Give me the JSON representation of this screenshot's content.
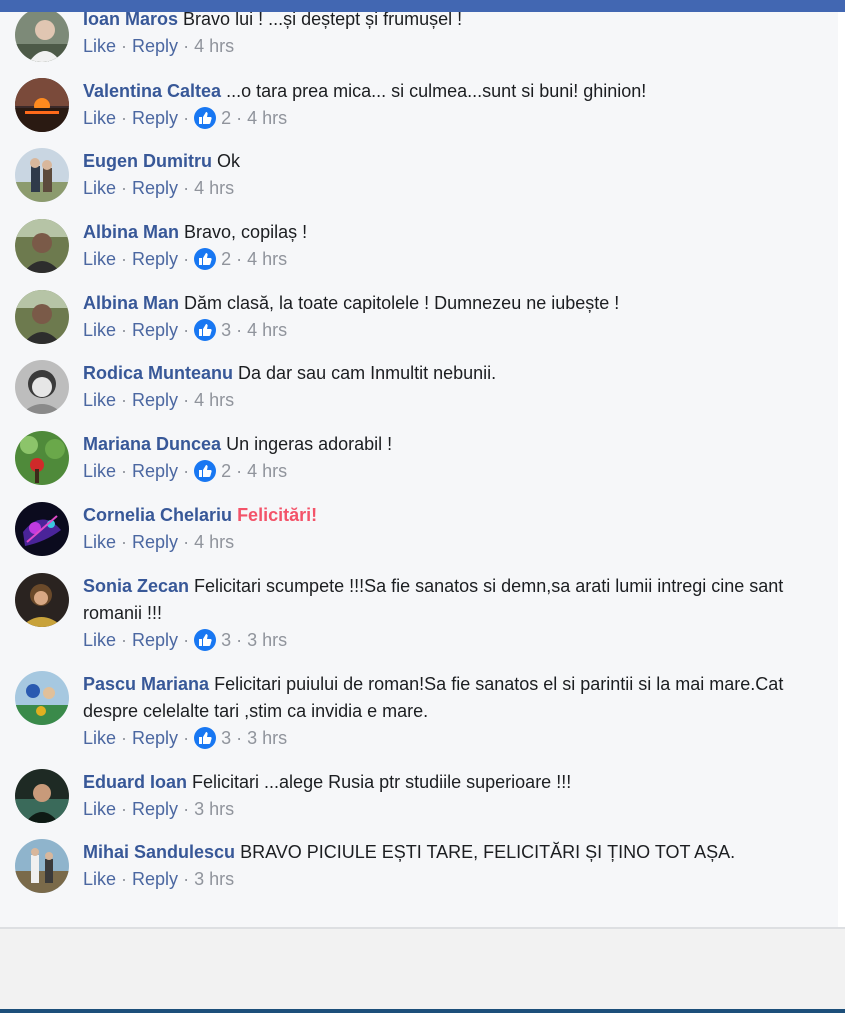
{
  "actions": {
    "like": "Like",
    "reply": "Reply",
    "separator": "·"
  },
  "comments": [
    {
      "author": "Ioan Maros",
      "text": "Bravo lui ! ...și deștept și frumușel !",
      "reactions": "",
      "time": "4 hrs"
    },
    {
      "author": "Valentina Caltea",
      "text": "...o tara prea mica... si culmea...sunt si buni! ghinion!",
      "reactions": "2",
      "time": "4 hrs"
    },
    {
      "author": "Eugen Dumitru",
      "text": "Ok",
      "reactions": "",
      "time": "4 hrs"
    },
    {
      "author": "Albina Man",
      "text": "Bravo, copilaș !",
      "reactions": "2",
      "time": "4 hrs"
    },
    {
      "author": "Albina Man",
      "text": "Dăm clasă, la toate capitolele ! Dumnezeu ne iubește !",
      "reactions": "3",
      "time": "4 hrs"
    },
    {
      "author": "Rodica Munteanu",
      "text": "Da dar sau cam Inmultit nebunii.",
      "reactions": "",
      "time": "4 hrs"
    },
    {
      "author": "Mariana Duncea",
      "text": "Un ingeras adorabil !",
      "reactions": "2",
      "time": "4 hrs"
    },
    {
      "author": "Cornelia Chelariu",
      "text": "Felicitări!",
      "reactions": "",
      "time": "4 hrs",
      "highlight": true
    },
    {
      "author": "Sonia Zecan",
      "text": "Felicitari scumpete !!!Sa fie sanatos si demn,sa arati lumii intregi cine sant romanii !!!",
      "reactions": "3",
      "time": "3 hrs"
    },
    {
      "author": "Pascu Mariana",
      "text": "Felicitari puiului de roman!Sa fie sanatos el si parintii si la mai mare.Cat despre celelalte tari ,stim ca invidia e mare.",
      "reactions": "3",
      "time": "3 hrs"
    },
    {
      "author": "Eduard Ioan",
      "text": "Felicitari ...alege Rusia ptr studiile superioare !!!",
      "reactions": "",
      "time": "3 hrs"
    },
    {
      "author": "Mihai Sandulescu",
      "text": "BRAVO PICIULE EȘTI TARE, FELICITĂRI ȘI ȚINO TOT AȘA.",
      "reactions": "",
      "time": "3 hrs"
    }
  ],
  "colors": {
    "author": "#385898",
    "action_link": "#4b67a1",
    "meta": "#90949c",
    "highlight": "#f35369",
    "like_badge": "#1877f2",
    "panel_bg": "#f6f7f9",
    "top_bar": "#4267b2"
  },
  "icons": {
    "like_badge": "thumbs-up-icon"
  }
}
